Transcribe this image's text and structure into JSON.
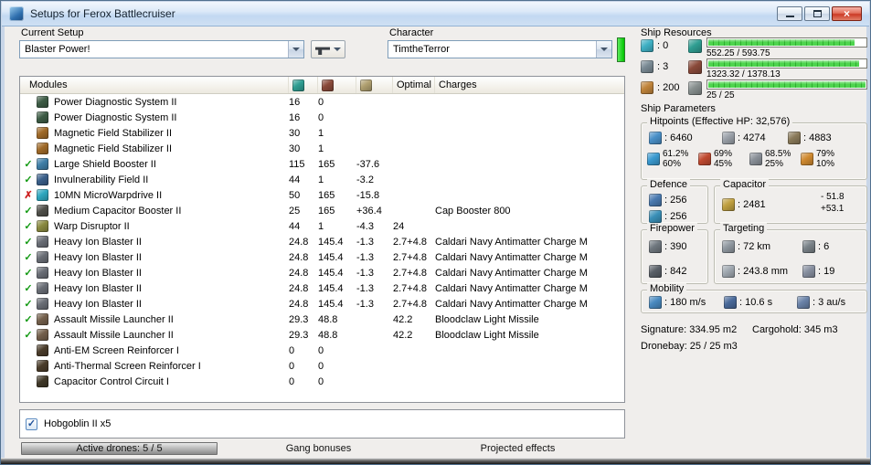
{
  "window": {
    "title": "Setups for Ferox Battlecruiser",
    "close_glyph": "×"
  },
  "toolbar": {
    "current_setup_label": "Current Setup",
    "current_setup_value": "Blaster Power!",
    "character_label": "Character",
    "character_value": "TimtheTerror"
  },
  "ship_resources": {
    "label": "Ship Resources",
    "rows": [
      {
        "icon": "turret-hardpoints-icon",
        "value": ": 0",
        "bar_icon": "cpu-icon",
        "bar_text": "552.25 / 593.75",
        "fraction": 0.93
      },
      {
        "icon": "launcher-hardpoints-icon",
        "value": ": 3",
        "bar_icon": "powergrid-icon",
        "bar_text": "1323.32 / 1378.13",
        "fraction": 0.96
      },
      {
        "icon": "calibration-icon",
        "value": ": 200",
        "bar_icon": "dronebay-icon",
        "bar_text": "25 / 25",
        "fraction": 1
      }
    ]
  },
  "ship_parameters": {
    "label": "Ship Parameters",
    "hitpoints": {
      "label": "Hitpoints (Effective HP: 32,576)",
      "hp": [
        {
          "icon": "shield-hp-icon",
          "value": ": 6460"
        },
        {
          "icon": "armor-hp-icon",
          "value": ": 4274"
        },
        {
          "icon": "structure-hp-icon",
          "value": ": 4883"
        }
      ],
      "resists": [
        {
          "icon": "em-resist-icon",
          "shield": "61.2%",
          "armor": "60%"
        },
        {
          "icon": "thermal-resist-icon",
          "shield": "69%",
          "armor": "45%"
        },
        {
          "icon": "kinetic-resist-icon",
          "shield": "68.5%",
          "armor": "25%"
        },
        {
          "icon": "explosive-resist-icon",
          "shield": "79%",
          "armor": "10%"
        }
      ]
    },
    "defence": {
      "label": "Defence",
      "stats": [
        {
          "icon": "shield-recharge-icon",
          "value": ": 256"
        },
        {
          "icon": "armor-repair-icon",
          "value": ": 256"
        }
      ]
    },
    "capacitor": {
      "label": "Capacitor",
      "stats": [
        {
          "icon": "capacitor-amount-icon",
          "value": ": 2481"
        }
      ],
      "delta_minus": "- 51.8",
      "delta_plus": "+53.1"
    },
    "firepower": {
      "label": "Firepower",
      "stats": [
        {
          "icon": "volley-damage-icon",
          "value": ": 390"
        },
        {
          "icon": "dps-icon",
          "value": ": 842"
        }
      ]
    },
    "targeting": {
      "label": "Targeting",
      "stats": [
        {
          "icon": "target-range-icon",
          "value": ": 72 km"
        },
        {
          "icon": "max-targets-icon",
          "value": ": 6"
        },
        {
          "icon": "scan-resolution-icon",
          "value": ": 243.8 mm"
        },
        {
          "icon": "sensor-strength-icon",
          "value": ": 19"
        }
      ]
    },
    "mobility": {
      "label": "Mobility",
      "stats": [
        {
          "icon": "max-velocity-icon",
          "value": ": 180 m/s"
        },
        {
          "icon": "align-time-icon",
          "value": ": 10.6 s"
        },
        {
          "icon": "warp-speed-icon",
          "value": ": 3 au/s"
        }
      ]
    },
    "signature": "Signature: 334.95 m2",
    "cargohold": "Cargohold: 345 m3",
    "dronebay": "Dronebay: 25 / 25 m3"
  },
  "modules_table": {
    "headers": {
      "modules": "Modules",
      "optimal": "Optimal",
      "charges": "Charges"
    },
    "header_icons": [
      "cpu-icon",
      "powergrid-icon",
      "cap-usage-icon"
    ],
    "rows": [
      {
        "status": "",
        "icon": "power-diagnostic-icon",
        "name": "Power Diagnostic System II",
        "cpu": "16",
        "pg": "0",
        "cap": "",
        "optimal": "",
        "charge": ""
      },
      {
        "status": "",
        "icon": "power-diagnostic-icon",
        "name": "Power Diagnostic System II",
        "cpu": "16",
        "pg": "0",
        "cap": "",
        "optimal": "",
        "charge": ""
      },
      {
        "status": "",
        "icon": "magnetic-stabilizer-icon",
        "name": "Magnetic Field Stabilizer II",
        "cpu": "30",
        "pg": "1",
        "cap": "",
        "optimal": "",
        "charge": ""
      },
      {
        "status": "",
        "icon": "magnetic-stabilizer-icon",
        "name": "Magnetic Field Stabilizer II",
        "cpu": "30",
        "pg": "1",
        "cap": "",
        "optimal": "",
        "charge": ""
      },
      {
        "status": "check",
        "icon": "shield-booster-icon",
        "name": "Large Shield Booster II",
        "cpu": "115",
        "pg": "165",
        "cap": "-37.6",
        "optimal": "",
        "charge": ""
      },
      {
        "status": "check",
        "icon": "invulnerability-field-icon",
        "name": "Invulnerability Field II",
        "cpu": "44",
        "pg": "1",
        "cap": "-3.2",
        "optimal": "",
        "charge": ""
      },
      {
        "status": "offline",
        "icon": "microwarpdrive-icon",
        "name": "10MN MicroWarpdrive II",
        "cpu": "50",
        "pg": "165",
        "cap": "-15.8",
        "optimal": "",
        "charge": ""
      },
      {
        "status": "check",
        "icon": "capacitor-booster-icon",
        "name": "Medium Capacitor Booster II",
        "cpu": "25",
        "pg": "165",
        "cap": "+36.4",
        "optimal": "",
        "charge": "Cap Booster 800"
      },
      {
        "status": "check",
        "icon": "warp-disruptor-icon",
        "name": "Warp Disruptor II",
        "cpu": "44",
        "pg": "1",
        "cap": "-4.3",
        "optimal": "24",
        "charge": ""
      },
      {
        "status": "check",
        "icon": "hybrid-turret-icon",
        "name": "Heavy Ion Blaster II",
        "cpu": "24.8",
        "pg": "145.4",
        "cap": "-1.3",
        "optimal": "2.7+4.8",
        "charge": "Caldari Navy Antimatter Charge M"
      },
      {
        "status": "check",
        "icon": "hybrid-turret-icon",
        "name": "Heavy Ion Blaster II",
        "cpu": "24.8",
        "pg": "145.4",
        "cap": "-1.3",
        "optimal": "2.7+4.8",
        "charge": "Caldari Navy Antimatter Charge M"
      },
      {
        "status": "check",
        "icon": "hybrid-turret-icon",
        "name": "Heavy Ion Blaster II",
        "cpu": "24.8",
        "pg": "145.4",
        "cap": "-1.3",
        "optimal": "2.7+4.8",
        "charge": "Caldari Navy Antimatter Charge M"
      },
      {
        "status": "check",
        "icon": "hybrid-turret-icon",
        "name": "Heavy Ion Blaster II",
        "cpu": "24.8",
        "pg": "145.4",
        "cap": "-1.3",
        "optimal": "2.7+4.8",
        "charge": "Caldari Navy Antimatter Charge M"
      },
      {
        "status": "check",
        "icon": "hybrid-turret-icon",
        "name": "Heavy Ion Blaster II",
        "cpu": "24.8",
        "pg": "145.4",
        "cap": "-1.3",
        "optimal": "2.7+4.8",
        "charge": "Caldari Navy Antimatter Charge M"
      },
      {
        "status": "check",
        "icon": "missile-launcher-icon",
        "name": "Assault Missile Launcher II",
        "cpu": "29.3",
        "pg": "48.8",
        "cap": "",
        "optimal": "42.2",
        "charge": "Bloodclaw Light Missile"
      },
      {
        "status": "check",
        "icon": "missile-launcher-icon",
        "name": "Assault Missile Launcher II",
        "cpu": "29.3",
        "pg": "48.8",
        "cap": "",
        "optimal": "42.2",
        "charge": "Bloodclaw Light Missile"
      },
      {
        "status": "",
        "icon": "shield-rig-icon",
        "name": "Anti-EM Screen Reinforcer I",
        "cpu": "0",
        "pg": "0",
        "cap": "",
        "optimal": "",
        "charge": ""
      },
      {
        "status": "",
        "icon": "shield-rig-icon",
        "name": "Anti-Thermal Screen Reinforcer I",
        "cpu": "0",
        "pg": "0",
        "cap": "",
        "optimal": "",
        "charge": ""
      },
      {
        "status": "",
        "icon": "capacitor-rig-icon",
        "name": "Capacitor Control Circuit I",
        "cpu": "0",
        "pg": "0",
        "cap": "",
        "optimal": "",
        "charge": ""
      }
    ]
  },
  "drone_panel": {
    "items": [
      {
        "checked": true,
        "label": "Hobgoblin II x5"
      }
    ]
  },
  "footer_tabs": [
    {
      "label": "Active drones: 5 / 5",
      "active": true
    },
    {
      "label": "Gang bonuses",
      "active": false
    },
    {
      "label": "Projected effects",
      "active": false
    }
  ],
  "icon_colors": {
    "turret-hardpoints-icon": "#3fb0c4",
    "launcher-hardpoints-icon": "#7a8a94",
    "calibration-icon": "#c0843a",
    "cpu-icon": "#2f9e92",
    "powergrid-icon": "#8a4a3a",
    "dronebay-icon": "#88908f",
    "cap-usage-icon": "#b0a070",
    "shield-hp-icon": "#4a90c8",
    "armor-hp-icon": "#9aa0a8",
    "structure-hp-icon": "#8a7a5a",
    "em-resist-icon": "#3a9ad0",
    "thermal-resist-icon": "#c04a30",
    "kinetic-resist-icon": "#8a9098",
    "explosive-resist-icon": "#d08a30",
    "shield-recharge-icon": "#4a7ab0",
    "armor-repair-icon": "#3a90b8",
    "capacitor-amount-icon": "#c0a040",
    "volley-damage-icon": "#70787f",
    "dps-icon": "#5a6068",
    "target-range-icon": "#9098a0",
    "max-targets-icon": "#7a8288",
    "scan-resolution-icon": "#a0a8b0",
    "sensor-strength-icon": "#8890a0",
    "max-velocity-icon": "#4a8ac0",
    "align-time-icon": "#4a6a9a",
    "warp-speed-icon": "#6a82a8",
    "power-diagnostic-icon": "#3d5c45",
    "magnetic-stabilizer-icon": "#a06a28",
    "shield-booster-icon": "#3f7fa8",
    "invulnerability-field-icon": "#3a5f8a",
    "microwarpdrive-icon": "#2fa8c0",
    "capacitor-booster-icon": "#50504a",
    "warp-disruptor-icon": "#8a8a40",
    "hybrid-turret-icon": "#6a6e76",
    "missile-launcher-icon": "#74604c",
    "shield-rig-icon": "#4a3c2a",
    "capacitor-rig-icon": "#403828"
  }
}
